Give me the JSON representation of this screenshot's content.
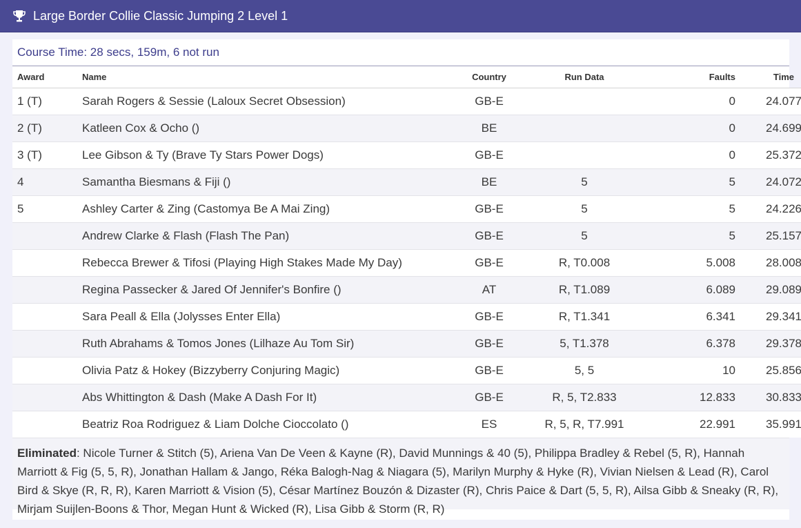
{
  "header": {
    "title": "Large Border Collie Classic Jumping 2 Level 1",
    "icon": "trophy-icon"
  },
  "course": {
    "text": "Course Time: 28 secs, 159m, 6 not run"
  },
  "columns": {
    "award": "Award",
    "name": "Name",
    "country": "Country",
    "run": "Run Data",
    "faults": "Faults",
    "time": "Time"
  },
  "rows": [
    {
      "award": "1 (T)",
      "name": "Sarah Rogers & Sessie (Laloux Secret Obsession)",
      "country": "GB-E",
      "run": "",
      "faults": "0",
      "time": "24.077"
    },
    {
      "award": "2 (T)",
      "name": "Katleen Cox & Ocho ()",
      "country": "BE",
      "run": "",
      "faults": "0",
      "time": "24.699"
    },
    {
      "award": "3 (T)",
      "name": "Lee Gibson & Ty (Brave Ty Stars Power Dogs)",
      "country": "GB-E",
      "run": "",
      "faults": "0",
      "time": "25.372"
    },
    {
      "award": "4",
      "name": "Samantha Biesmans & Fiji ()",
      "country": "BE",
      "run": "5",
      "faults": "5",
      "time": "24.072"
    },
    {
      "award": "5",
      "name": "Ashley Carter & Zing (Castomya Be A Mai Zing)",
      "country": "GB-E",
      "run": "5",
      "faults": "5",
      "time": "24.226"
    },
    {
      "award": "",
      "name": "Andrew Clarke & Flash (Flash The Pan)",
      "country": "GB-E",
      "run": "5",
      "faults": "5",
      "time": "25.157"
    },
    {
      "award": "",
      "name": "Rebecca Brewer & Tifosi (Playing High Stakes Made My Day)",
      "country": "GB-E",
      "run": "R, T0.008",
      "faults": "5.008",
      "time": "28.008"
    },
    {
      "award": "",
      "name": "Regina Passecker & Jared Of Jennifer's Bonfire ()",
      "country": "AT",
      "run": "R, T1.089",
      "faults": "6.089",
      "time": "29.089"
    },
    {
      "award": "",
      "name": "Sara Peall & Ella (Jolysses Enter Ella)",
      "country": "GB-E",
      "run": "R, T1.341",
      "faults": "6.341",
      "time": "29.341"
    },
    {
      "award": "",
      "name": "Ruth Abrahams & Tomos Jones (Lilhaze Au Tom Sir)",
      "country": "GB-E",
      "run": "5, T1.378",
      "faults": "6.378",
      "time": "29.378"
    },
    {
      "award": "",
      "name": "Olivia Patz & Hokey (Bizzyberry Conjuring Magic)",
      "country": "GB-E",
      "run": "5, 5",
      "faults": "10",
      "time": "25.856"
    },
    {
      "award": "",
      "name": "Abs Whittington & Dash (Make A Dash For It)",
      "country": "GB-E",
      "run": "R, 5, T2.833",
      "faults": "12.833",
      "time": "30.833"
    },
    {
      "award": "",
      "name": "Beatriz Roa Rodriguez & Liam Dolche Cioccolato ()",
      "country": "ES",
      "run": "R, 5, R, T7.991",
      "faults": "22.991",
      "time": "35.991"
    }
  ],
  "eliminated": {
    "label": "Eliminated",
    "text": ": Nicole Turner & Stitch (5), Ariena Van De Veen & Kayne (R), David Munnings & 40 (5), Philippa Bradley & Rebel (5, R), Hannah Marriott & Fig (5, 5, R), Jonathan Hallam & Jango, Réka Balogh-Nag & Niagara (5), Marilyn Murphy & Hyke (R), Vivian Nielsen & Lead (R), Carol Bird & Skye (R, R, R), Karen Marriott & Vision (5), César Martínez Bouzón & Dizaster (R), Chris Paice & Dart (5, 5, R), Ailsa Gibb & Sneaky (R, R), Mirjam Suijlen-Boons & Thor, Megan Hunt & Wicked (R), Lisa Gibb & Storm (R, R)"
  },
  "colors": {
    "header_bg": "#4a4a94",
    "accent_text": "#3d3d8c",
    "stripe": "#f3f3f8"
  }
}
